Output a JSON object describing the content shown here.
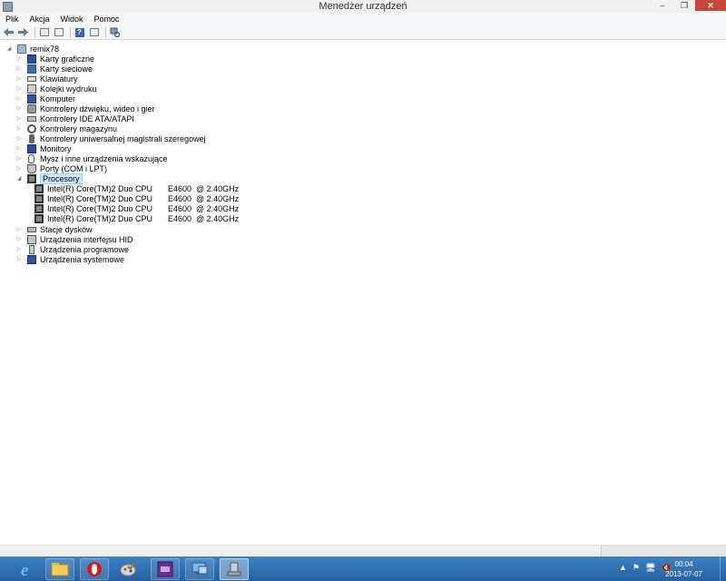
{
  "window": {
    "title": "Menedżer urządzeń",
    "minimize_label": "–",
    "maximize_label": "❐",
    "close_label": "✕"
  },
  "menu": [
    "Plik",
    "Akcja",
    "Widok",
    "Pomoc"
  ],
  "toolbar": {
    "icons": [
      "back-arrow-icon",
      "forward-arrow-icon",
      "show-hide-console-tree-icon",
      "properties-icon",
      "help-icon",
      "action-pane-icon",
      "scan-hardware-icon"
    ]
  },
  "tree": {
    "root": "remix78",
    "categories": [
      {
        "label": "Karty graficzne",
        "icon": "display-adapter-icon",
        "expanded": false
      },
      {
        "label": "Karty sieciowe",
        "icon": "network-adapter-icon",
        "expanded": false
      },
      {
        "label": "Klawiatury",
        "icon": "keyboard-icon",
        "expanded": false
      },
      {
        "label": "Kolejki wydruku",
        "icon": "printer-icon",
        "expanded": false
      },
      {
        "label": "Komputer",
        "icon": "computer-icon",
        "expanded": false
      },
      {
        "label": "Kontrolery dźwięku, wideo i gier",
        "icon": "speaker-icon",
        "expanded": false
      },
      {
        "label": "Kontrolery IDE ATA/ATAPI",
        "icon": "ide-controller-icon",
        "expanded": false
      },
      {
        "label": "Kontrolery magazynu",
        "icon": "storage-controller-icon",
        "expanded": false
      },
      {
        "label": "Kontrolery uniwersalnej magistrali szeregowej",
        "icon": "usb-icon",
        "expanded": false
      },
      {
        "label": "Monitory",
        "icon": "monitor-icon",
        "expanded": false
      },
      {
        "label": "Mysz i inne urządzenia wskazujące",
        "icon": "mouse-icon",
        "expanded": false
      },
      {
        "label": "Porty (COM i LPT)",
        "icon": "port-icon",
        "expanded": false
      },
      {
        "label": "Procesory",
        "icon": "processor-icon",
        "expanded": true,
        "selected": true
      },
      {
        "label": "Stacje dysków",
        "icon": "disk-drive-icon",
        "expanded": false
      },
      {
        "label": "Urządzenia interfejsu HID",
        "icon": "hid-icon",
        "expanded": false
      },
      {
        "label": "Urządzenia programowe",
        "icon": "software-device-icon",
        "expanded": false
      },
      {
        "label": "Urządzenia systemowe",
        "icon": "system-device-icon",
        "expanded": false
      }
    ],
    "processors": [
      {
        "model": "Intel(R) Core(TM)2 Duo CPU",
        "speed": "E4600  @ 2.40GHz"
      },
      {
        "model": "Intel(R) Core(TM)2 Duo CPU",
        "speed": "E4600  @ 2.40GHz"
      },
      {
        "model": "Intel(R) Core(TM)2 Duo CPU",
        "speed": "E4600  @ 2.40GHz"
      },
      {
        "model": "Intel(R) Core(TM)2 Duo CPU",
        "speed": "E4600  @ 2.40GHz"
      }
    ]
  },
  "taskbar": {
    "apps": [
      "internet-explorer-icon",
      "file-explorer-icon",
      "opera-icon",
      "paint-icon",
      "cpu-z-icon",
      "remote-desktop-icon",
      "device-manager-icon"
    ],
    "tray": [
      "▲",
      "⚑",
      "🖥",
      "🔇"
    ],
    "time": "00:04",
    "date": "2013-07-07"
  },
  "colors": {
    "selection": "#cce8ff",
    "taskbar": "#2c6fb0",
    "close_button": "#c7463b"
  }
}
